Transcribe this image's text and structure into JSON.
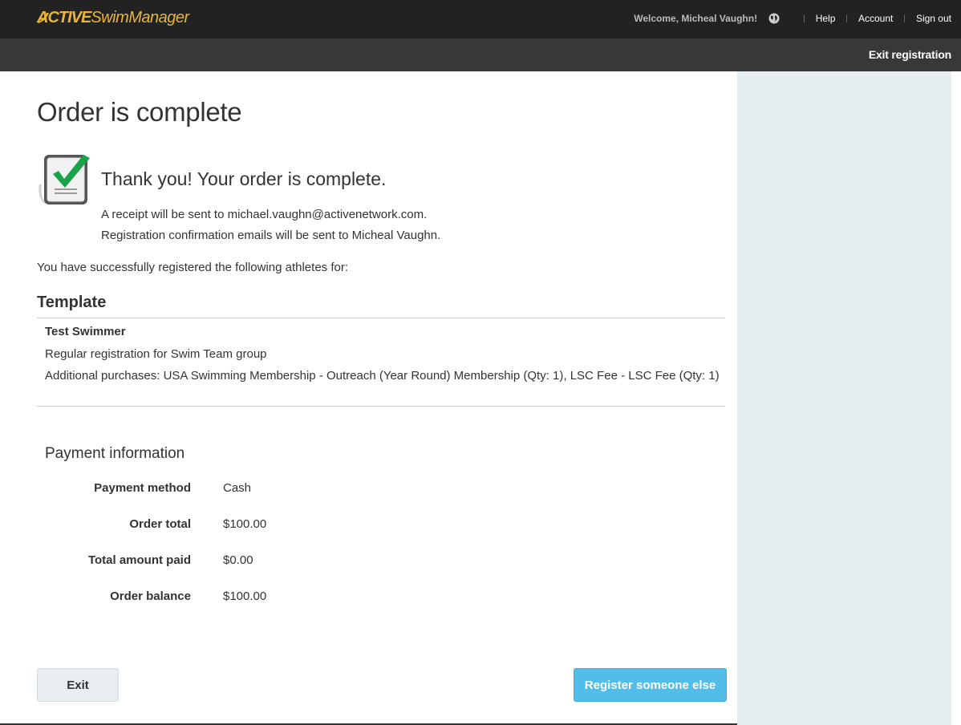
{
  "header": {
    "brand_bold": "ACTIVE",
    "brand_light": "SwimManager",
    "welcome": "Welcome, Micheal Vaughn!",
    "globe_icon": "globe-icon",
    "links": [
      "Help",
      "Account",
      "Sign out"
    ],
    "separator": "|",
    "exit_registration": "Exit registration"
  },
  "main": {
    "title": "Order is complete",
    "thanks": "Thank you! Your order is complete.",
    "receipt": "A receipt will be sent to michael.vaughn@activenetwork.com.",
    "confirmation": "Registration confirmation emails will be sent to Micheal Vaughn.",
    "success": "You have successfully registered the following athletes for:",
    "program": "Template",
    "athlete": {
      "name": "Test Swimmer",
      "registration": "Regular registration for Swim Team group",
      "additional": "Additional purchases: USA Swimming Membership - Outreach (Year Round) Membership (Qty: 1), LSC Fee - LSC Fee (Qty: 1)"
    },
    "payment": {
      "title": "Payment information",
      "rows": [
        {
          "label": "Payment method",
          "value": "Cash"
        },
        {
          "label": "Order total",
          "value": "$100.00"
        },
        {
          "label": "Total amount paid",
          "value": "$0.00"
        },
        {
          "label": "Order balance",
          "value": "$100.00"
        }
      ]
    },
    "buttons": {
      "exit": "Exit",
      "register": "Register someone else"
    }
  },
  "colors": {
    "topbar": "#222222",
    "subbar": "#383838",
    "brand": "#e8b43c",
    "side_panel": "#e6edf0",
    "primary_button": "#52bde9",
    "check": "#1aa34a"
  }
}
